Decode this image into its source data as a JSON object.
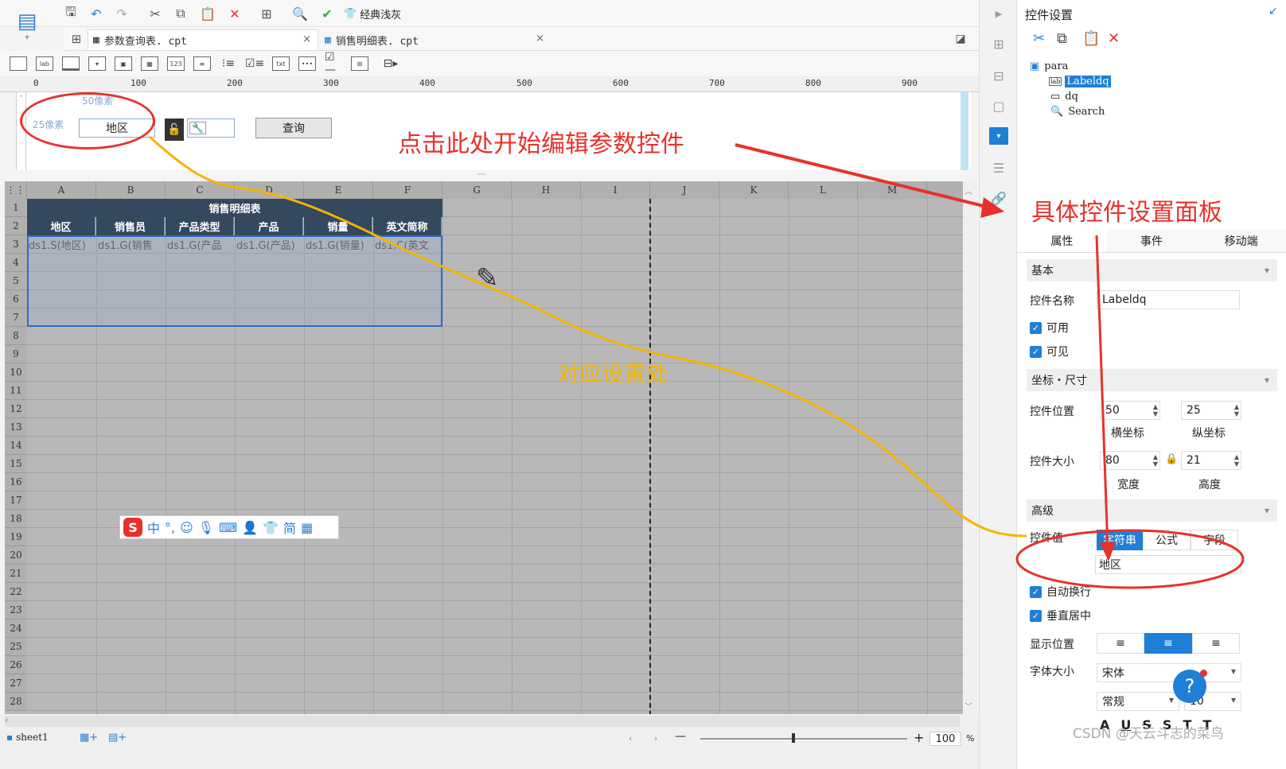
{
  "toolbar": {
    "classic_theme_label": "经典浅灰"
  },
  "tabs": [
    {
      "label": "参数查询表. cpt",
      "close": "×"
    },
    {
      "label": "销售明细表. cpt",
      "close": "×"
    }
  ],
  "widget_toolbar": {
    "label_icon": "lab",
    "number_icon": "123",
    "text_icon": "txt"
  },
  "ruler": {
    "ticks": [
      "0",
      "100",
      "200",
      "300",
      "400",
      "500",
      "600",
      "700",
      "800",
      "900"
    ]
  },
  "para_canvas": {
    "px50_hint": "50像素",
    "px25_hint": "25像素",
    "label_value": "地区",
    "query_button": "查询"
  },
  "sheet": {
    "columns": [
      "A",
      "B",
      "C",
      "D",
      "E",
      "F",
      "G",
      "H",
      "I",
      "J",
      "K",
      "L",
      "M"
    ],
    "rows": [
      "1",
      "2",
      "3",
      "4",
      "5",
      "6",
      "7",
      "8",
      "9",
      "10",
      "11",
      "12",
      "13",
      "14",
      "15",
      "16",
      "17",
      "18",
      "19",
      "20",
      "21",
      "22",
      "23",
      "24",
      "25",
      "26",
      "27",
      "28"
    ],
    "title": "销售明细表",
    "headers": [
      "地区",
      "销售员",
      "产品类型",
      "产品",
      "销量",
      "英文简称"
    ],
    "data_row": [
      "ds1.S(地区)",
      "ds1.G(销售",
      "ds1.G(产品",
      "ds1.G(产品)",
      "ds1.G(销量)",
      "ds1.C(英文"
    ],
    "tab_name": "sheet1",
    "zoom": "100",
    "zoom_unit": "%",
    "zoom_minus": "—",
    "zoom_plus": "+"
  },
  "ime_bar": {
    "items": [
      "中",
      "°,",
      "☺",
      "🎤",
      "⌨",
      "简",
      "▦"
    ]
  },
  "annotations": {
    "click_here": "点击此处开始编辑参数控件",
    "panel_note": "具体控件设置面板",
    "corresponding": "对应设置处"
  },
  "panel": {
    "title": "控件设置",
    "tree": {
      "root": "para",
      "items": [
        "Labeldq",
        "dq",
        "Search"
      ],
      "label_icon": "lab"
    },
    "tabs": [
      "属性",
      "事件",
      "移动端"
    ],
    "basic": {
      "section": "基本",
      "name_label": "控件名称",
      "name_value": "Labeldq",
      "enabled": "可用",
      "visible": "可见"
    },
    "position": {
      "section": "坐标・尺寸",
      "pos_label": "控件位置",
      "x_value": "50",
      "y_value": "25",
      "x_caption": "横坐标",
      "y_caption": "纵坐标",
      "size_label": "控件大小",
      "w_value": "80",
      "h_value": "21",
      "w_caption": "宽度",
      "h_caption": "高度"
    },
    "advanced": {
      "section": "高级",
      "value_label": "控件值",
      "value_modes": [
        "字符串",
        "公式",
        "字段"
      ],
      "value_text": "地区",
      "auto_wrap": "自动换行",
      "vcenter": "垂直居中",
      "align_label": "显示位置",
      "font_label": "字体大小",
      "font_name": "宋体",
      "font_style": "常规",
      "font_size": "10",
      "styles": [
        "A",
        "U",
        "S",
        "S",
        "T",
        "T"
      ]
    },
    "help": "?"
  },
  "watermark": "CSDN @天云斗志的菜鸟",
  "colors": {
    "accent": "#1e7fd6",
    "annotation_red": "#e8312a",
    "annotation_yellow": "#f5b400",
    "header_dark": "#34495e"
  }
}
